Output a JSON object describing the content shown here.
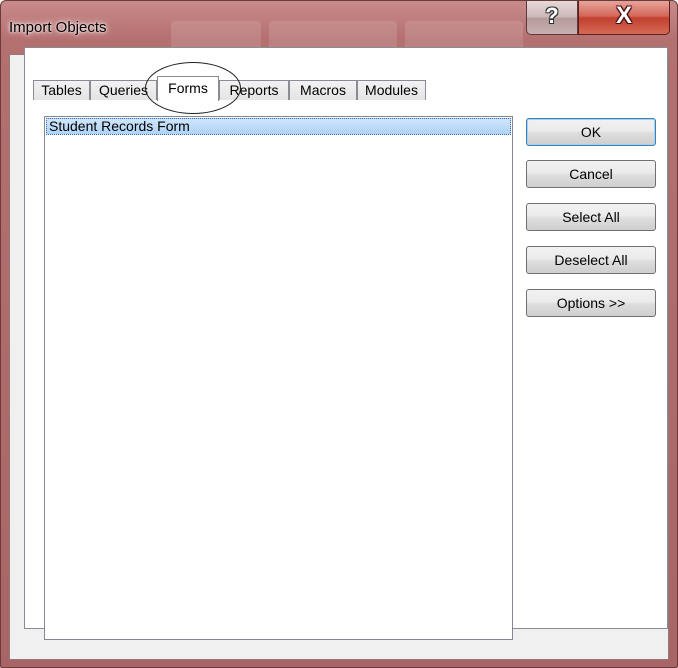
{
  "window": {
    "title": "Import Objects",
    "help_glyph": "?",
    "close_glyph": "X",
    "help_icon": "help-icon",
    "close_icon": "close-icon"
  },
  "tabs": [
    {
      "label": "Tables"
    },
    {
      "label": "Queries"
    },
    {
      "label": "Forms",
      "selected": true
    },
    {
      "label": "Reports"
    },
    {
      "label": "Macros"
    },
    {
      "label": "Modules"
    }
  ],
  "objects": {
    "items": [
      {
        "label": "Student Records Form",
        "selected": true
      }
    ]
  },
  "buttons": {
    "ok": "OK",
    "cancel": "Cancel",
    "select_all": "Select All",
    "deselect_all": "Deselect All",
    "options": "Options >>"
  },
  "colors": {
    "titlebar": "#b46f6f",
    "close_button": "#c2402f",
    "selection": "#aed3f6",
    "default_button_border": "#3c7fb1"
  }
}
